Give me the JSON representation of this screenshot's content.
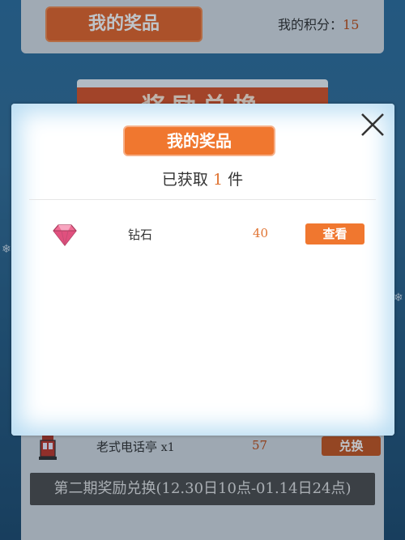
{
  "header": {
    "tab_label": "我的奖品",
    "points_label": "我的积分：",
    "points_value": "15"
  },
  "banner": {
    "text": "奖励兑换"
  },
  "background_list": {
    "items": [
      {
        "name": "老式电话亭",
        "qty": "x1",
        "points": "57",
        "button": "兑换"
      }
    ]
  },
  "footer": {
    "text": "第二期奖励兑换(12.30日10点-01.14日24点)"
  },
  "modal": {
    "title": "我的奖品",
    "obtained_prefix": "已获取",
    "obtained_count": "1",
    "obtained_suffix": "件",
    "items": [
      {
        "icon": "diamond-icon",
        "name": "钻石",
        "points": "40",
        "button": "查看"
      }
    ]
  },
  "colors": {
    "accent": "#f0772f",
    "points_text": "#e07433",
    "diamond": "#e85b86"
  }
}
